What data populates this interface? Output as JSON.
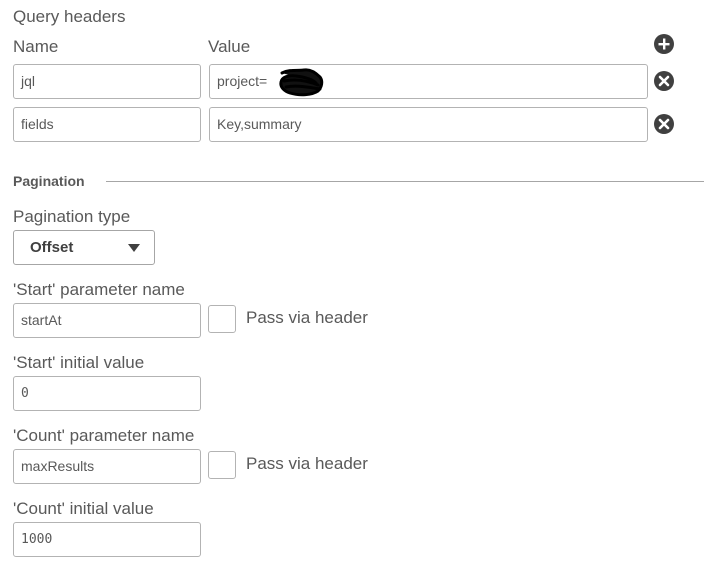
{
  "query_headers": {
    "title": "Query headers",
    "name_col": "Name",
    "value_col": "Value",
    "add_icon": "plus-circle-icon",
    "rows": [
      {
        "name": "jql",
        "value": "project=",
        "remove_icon": "x-circle-icon"
      },
      {
        "name": "fields",
        "value": "Key,summary",
        "remove_icon": "x-circle-icon"
      }
    ]
  },
  "pagination": {
    "section_title": "Pagination",
    "type_label": "Pagination type",
    "type_value": "Offset",
    "type_caret_icon": "caret-down-icon",
    "start_param_label": "'Start' parameter name",
    "start_param_value": "startAt",
    "start_pass_via_header_label": "Pass via header",
    "start_pass_via_header_checked": false,
    "start_initial_label": "'Start' initial value",
    "start_initial_value": "0",
    "count_param_label": "'Count' parameter name",
    "count_param_value": "maxResults",
    "count_pass_via_header_label": "Pass via header",
    "count_pass_via_header_checked": false,
    "count_initial_label": "'Count' initial value",
    "count_initial_value": "1000"
  },
  "colors": {
    "text": "#595959",
    "border": "#b3b3b3",
    "icon": "#404040"
  }
}
